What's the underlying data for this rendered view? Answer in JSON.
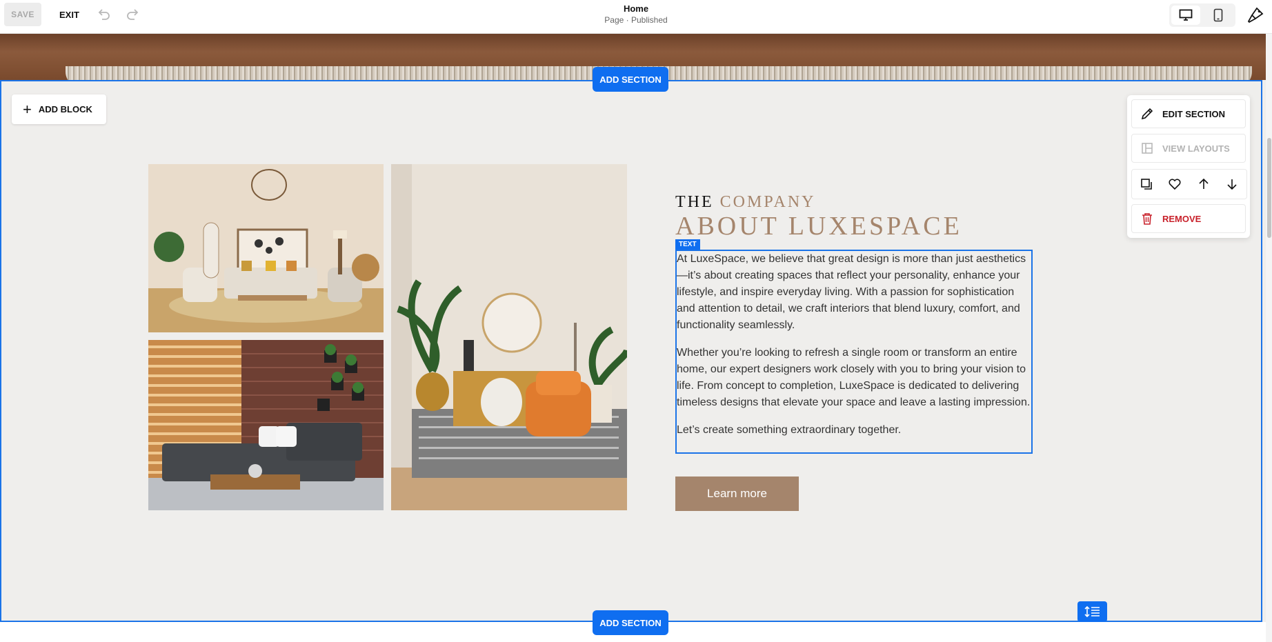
{
  "topbar": {
    "save_label": "SAVE",
    "exit_label": "EXIT",
    "page_title": "Home",
    "page_status": "Page · Published"
  },
  "editor": {
    "add_section_label": "ADD SECTION",
    "add_block_label": "ADD BLOCK",
    "text_tag": "TEXT"
  },
  "section_panel": {
    "edit_label": "EDIT SECTION",
    "layouts_label": "VIEW LAYOUTS",
    "remove_label": "REMOVE"
  },
  "content": {
    "heading_prefix": "THE",
    "heading_accent": "COMPANY",
    "heading_main": "ABOUT LUXESPACE",
    "paragraphs": [
      "At LuxeSpace, we believe that great design is more than just aesthetics—it’s about creating spaces that reflect your personality, enhance your lifestyle, and inspire everyday living. With a passion for sophistication and attention to detail, we craft interiors that blend luxury, comfort, and functionality seamlessly.",
      "Whether you’re looking to refresh a single room or transform an entire home, our expert designers work closely with you to bring your vision to life. From concept to completion, LuxeSpace is dedicated to delivering timeless designs that elevate your space and leave a lasting impression.",
      "Let’s create something extraordinary together."
    ],
    "button_label": "Learn more"
  },
  "colors": {
    "accent": "#a5856c",
    "selection_blue": "#1a73e8",
    "remove_red": "#c8202a"
  }
}
